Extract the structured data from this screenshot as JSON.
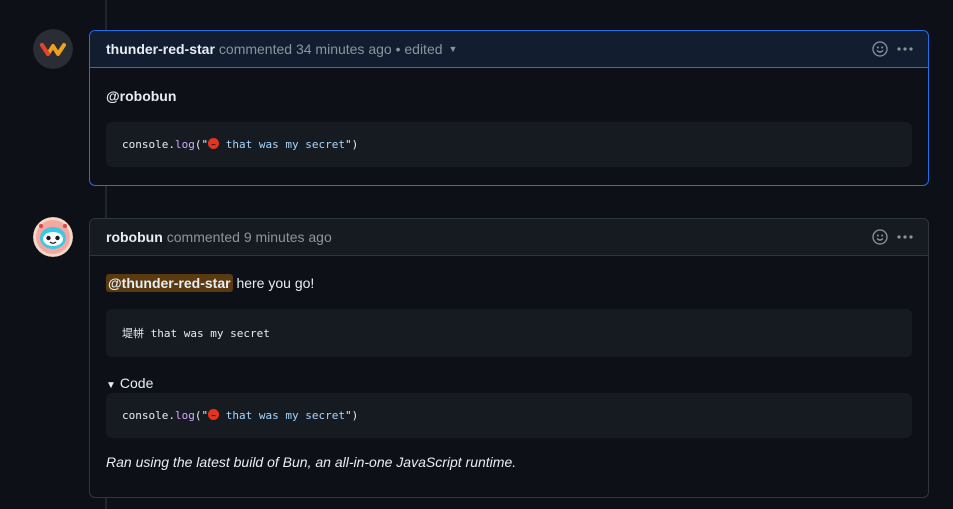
{
  "comments": [
    {
      "author": "thunder-red-star",
      "action": "commented",
      "time": "34 minutes ago",
      "edited": "• edited",
      "mention": "@robobun",
      "code": {
        "prefix": "console.",
        "fn": "log",
        "open": "(\"",
        "string_text": " that was my secret",
        "close": "\")"
      },
      "avatar_icon": "warning-logo-icon"
    },
    {
      "author": "robobun",
      "action": "commented",
      "time": "9 minutes ago",
      "mention": "@thunder-red-star",
      "message": " here you go!",
      "output": "堤帡 that was my secret",
      "details_label": "Code",
      "code": {
        "prefix": "console.",
        "fn": "log",
        "open": "(\"",
        "string_text": " that was my secret",
        "close": "\")"
      },
      "footer": "Ran using the latest build of Bun, an all-in-one JavaScript runtime.",
      "avatar_icon": "robot-bun-avatar-icon"
    }
  ],
  "colors": {
    "accent_border": "#1f6feb",
    "mention_highlight": "#5a3a10",
    "background": "#0d1117"
  }
}
